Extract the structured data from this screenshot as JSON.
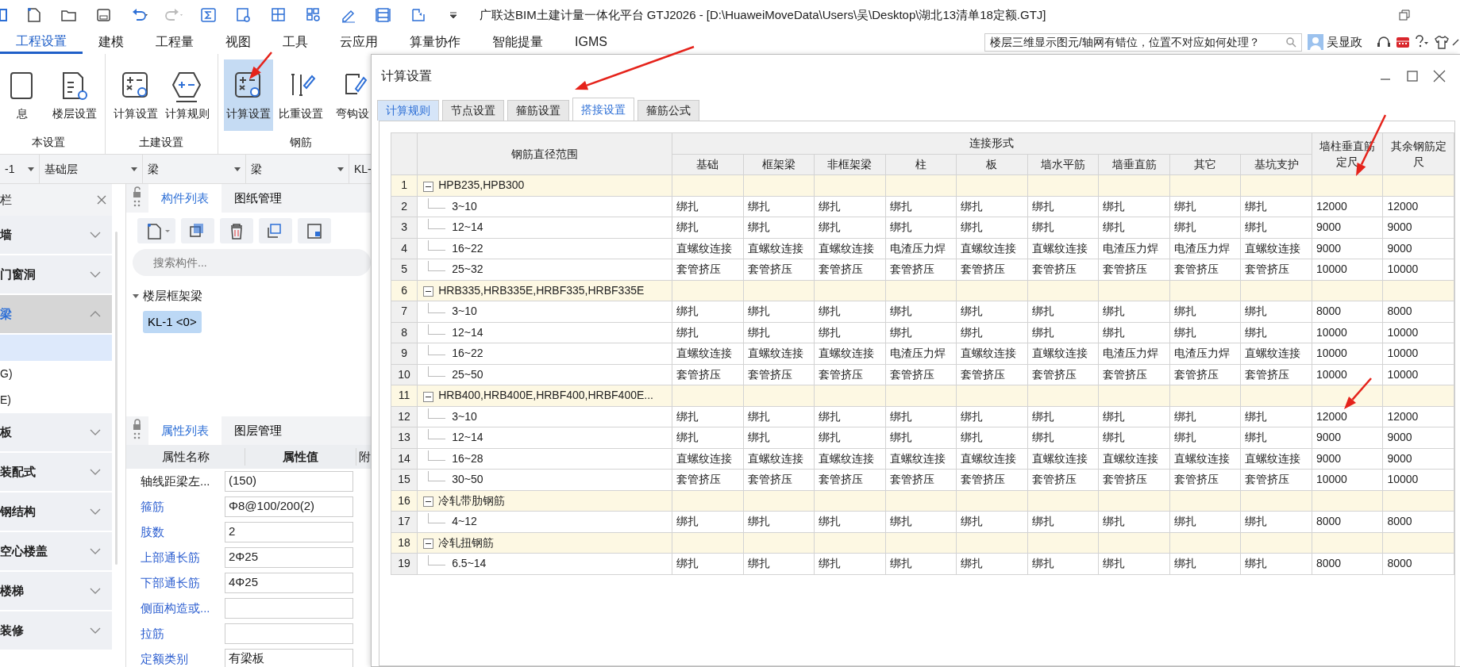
{
  "title_bar": {
    "title": "广联达BIM土建计量一体化平台 GTJ2026 - [D:\\HuaweiMoveData\\Users\\吴\\Desktop\\湖北13清单18定额.GTJ]"
  },
  "menu_tabs": [
    {
      "label": "工程设置",
      "selected": true
    },
    {
      "label": "建模",
      "selected": false
    },
    {
      "label": "工程量",
      "selected": false
    },
    {
      "label": "视图",
      "selected": false
    },
    {
      "label": "工具",
      "selected": false
    },
    {
      "label": "云应用",
      "selected": false
    },
    {
      "label": "算量协作",
      "selected": false
    },
    {
      "label": "智能提量",
      "selected": false
    },
    {
      "label": "IGMS",
      "selected": false
    }
  ],
  "help_search": {
    "value": "楼层三维显示图元/轴网有错位，位置不对应如何处理？"
  },
  "user": {
    "name": "吴显政"
  },
  "ribbon": [
    {
      "label": "本设置",
      "buttons": [
        {
          "label": "息",
          "selected": false
        },
        {
          "label": "楼层设置",
          "selected": false
        }
      ]
    },
    {
      "label": "土建设置",
      "buttons": [
        {
          "label": "计算设置",
          "selected": false
        },
        {
          "label": "计算规则",
          "selected": false
        }
      ]
    },
    {
      "label": "钢筋",
      "buttons": [
        {
          "label": "计算设置",
          "selected": true
        },
        {
          "label": "比重设置",
          "selected": false
        },
        {
          "label": "弯钩设",
          "selected": false
        }
      ]
    }
  ],
  "selectors": [
    "-1",
    "基础层",
    "梁",
    "梁",
    "KL-"
  ],
  "nav_panel": {
    "title": "栏",
    "items": [
      {
        "label": "墙",
        "expanded": false
      },
      {
        "label": "门窗洞",
        "expanded": false
      },
      {
        "label": "梁",
        "expanded": true,
        "children": [
          {
            "selected": true
          },
          {
            "label": "G)",
            "selected": false
          },
          {
            "label": "E)",
            "selected": false
          }
        ]
      },
      {
        "label": "板",
        "expanded": false
      },
      {
        "label": "装配式",
        "expanded": false
      },
      {
        "label": "钢结构",
        "expanded": false
      },
      {
        "label": "空心楼盖",
        "expanded": false
      },
      {
        "label": "楼梯",
        "expanded": false
      },
      {
        "label": "装修",
        "expanded": false
      }
    ]
  },
  "component_panel": {
    "tabs": [
      {
        "label": "构件列表",
        "selected": true
      },
      {
        "label": "图纸管理",
        "selected": false
      }
    ],
    "search": {
      "placeholder": "搜索构件..."
    },
    "tree": [
      {
        "label": "楼层框架梁",
        "expanded": true,
        "children": [
          {
            "label": "KL-1 <0>",
            "selected": true
          }
        ]
      }
    ]
  },
  "property_panel": {
    "tabs": [
      {
        "label": "属性列表",
        "selected": true
      },
      {
        "label": "图层管理",
        "selected": false
      }
    ],
    "columns": [
      "属性名称",
      "属性值",
      "附"
    ],
    "rows": [
      {
        "name": "轴线距梁左...",
        "value": "(150)",
        "color": "#222222"
      },
      {
        "name": "箍筋",
        "value": "Φ8@100/200(2)",
        "color": "#2d5fd0"
      },
      {
        "name": "肢数",
        "value": "2",
        "color": "#2d5fd0"
      },
      {
        "name": "上部通长筋",
        "value": "2Φ25",
        "color": "#2d5fd0"
      },
      {
        "name": "下部通长筋",
        "value": "4Φ25",
        "color": "#2d5fd0"
      },
      {
        "name": "侧面构造或...",
        "color": "#2d5fd0"
      },
      {
        "name": "拉筋",
        "color": "#2d5fd0"
      },
      {
        "name": "定额类别",
        "value": "有梁板",
        "color": "#2d5fd0"
      }
    ]
  },
  "dialog": {
    "title": "计算设置",
    "tabs": [
      {
        "label": "计算规则",
        "selected": false,
        "hovered": true
      },
      {
        "label": "节点设置",
        "selected": false,
        "hovered": false
      },
      {
        "label": "箍筋设置",
        "selected": false,
        "hovered": false
      },
      {
        "label": "搭接设置",
        "selected": true,
        "hovered": false
      },
      {
        "label": "箍筋公式",
        "selected": false,
        "hovered": false
      }
    ],
    "table": {
      "name_header": "钢筋直径范围",
      "group_header": "连接形式",
      "group_columns": [
        "基础",
        "框架梁",
        "非框架梁",
        "柱",
        "板",
        "墙水平筋",
        "墙垂直筋",
        "其它",
        "基坑支护"
      ],
      "extra_columns": [
        "墙柱垂直筋定尺",
        "其余钢筋定尺"
      ],
      "rows": [
        {
          "number": "1",
          "kind": "group",
          "label": "HPB235,HPB300",
          "expanded": true
        },
        {
          "number": "2",
          "kind": "item",
          "label": "3~10",
          "cells": [
            "绑扎",
            "绑扎",
            "绑扎",
            "绑扎",
            "绑扎",
            "绑扎",
            "绑扎",
            "绑扎",
            "绑扎",
            "12000",
            "12000"
          ]
        },
        {
          "number": "3",
          "kind": "item",
          "label": "12~14",
          "cells": [
            "绑扎",
            "绑扎",
            "绑扎",
            "绑扎",
            "绑扎",
            "绑扎",
            "绑扎",
            "绑扎",
            "绑扎",
            "9000",
            "9000"
          ]
        },
        {
          "number": "4",
          "kind": "item",
          "label": "16~22",
          "cells": [
            "直螺纹连接",
            "直螺纹连接",
            "直螺纹连接",
            "电渣压力焊",
            "直螺纹连接",
            "直螺纹连接",
            "电渣压力焊",
            "电渣压力焊",
            "直螺纹连接",
            "9000",
            "9000"
          ]
        },
        {
          "number": "5",
          "kind": "item",
          "label": "25~32",
          "cells": [
            "套管挤压",
            "套管挤压",
            "套管挤压",
            "套管挤压",
            "套管挤压",
            "套管挤压",
            "套管挤压",
            "套管挤压",
            "套管挤压",
            "10000",
            "10000"
          ]
        },
        {
          "number": "6",
          "kind": "group",
          "label": "HRB335,HRB335E,HRBF335,HRBF335E",
          "expanded": true
        },
        {
          "number": "7",
          "kind": "item",
          "label": "3~10",
          "cells": [
            "绑扎",
            "绑扎",
            "绑扎",
            "绑扎",
            "绑扎",
            "绑扎",
            "绑扎",
            "绑扎",
            "绑扎",
            "8000",
            "8000"
          ]
        },
        {
          "number": "8",
          "kind": "item",
          "label": "12~14",
          "cells": [
            "绑扎",
            "绑扎",
            "绑扎",
            "绑扎",
            "绑扎",
            "绑扎",
            "绑扎",
            "绑扎",
            "绑扎",
            "10000",
            "10000"
          ]
        },
        {
          "number": "9",
          "kind": "item",
          "label": "16~22",
          "cells": [
            "直螺纹连接",
            "直螺纹连接",
            "直螺纹连接",
            "电渣压力焊",
            "直螺纹连接",
            "直螺纹连接",
            "电渣压力焊",
            "电渣压力焊",
            "直螺纹连接",
            "10000",
            "10000"
          ]
        },
        {
          "number": "10",
          "kind": "item",
          "label": "25~50",
          "cells": [
            "套管挤压",
            "套管挤压",
            "套管挤压",
            "套管挤压",
            "套管挤压",
            "套管挤压",
            "套管挤压",
            "套管挤压",
            "套管挤压",
            "10000",
            "10000"
          ]
        },
        {
          "number": "11",
          "kind": "group",
          "label": "HRB400,HRB400E,HRBF400,HRBF400E...",
          "expanded": true
        },
        {
          "number": "12",
          "kind": "item",
          "label": "3~10",
          "cells": [
            "绑扎",
            "绑扎",
            "绑扎",
            "绑扎",
            "绑扎",
            "绑扎",
            "绑扎",
            "绑扎",
            "绑扎",
            "12000",
            "12000"
          ]
        },
        {
          "number": "13",
          "kind": "item",
          "label": "12~14",
          "cells": [
            "绑扎",
            "绑扎",
            "绑扎",
            "绑扎",
            "绑扎",
            "绑扎",
            "绑扎",
            "绑扎",
            "绑扎",
            "9000",
            "9000"
          ]
        },
        {
          "number": "14",
          "kind": "item",
          "label": "16~28",
          "cells": [
            "直螺纹连接",
            "直螺纹连接",
            "直螺纹连接",
            "直螺纹连接",
            "直螺纹连接",
            "直螺纹连接",
            "直螺纹连接",
            "直螺纹连接",
            "直螺纹连接",
            "9000",
            "9000"
          ]
        },
        {
          "number": "15",
          "kind": "item",
          "label": "30~50",
          "cells": [
            "套管挤压",
            "套管挤压",
            "套管挤压",
            "套管挤压",
            "套管挤压",
            "套管挤压",
            "套管挤压",
            "套管挤压",
            "套管挤压",
            "10000",
            "10000"
          ]
        },
        {
          "number": "16",
          "kind": "group",
          "label": "冷轧带肋钢筋",
          "expanded": true
        },
        {
          "number": "17",
          "kind": "item",
          "label": "4~12",
          "cells": [
            "绑扎",
            "绑扎",
            "绑扎",
            "绑扎",
            "绑扎",
            "绑扎",
            "绑扎",
            "绑扎",
            "绑扎",
            "8000",
            "8000"
          ]
        },
        {
          "number": "18",
          "kind": "group",
          "label": "冷轧扭钢筋",
          "expanded": true
        },
        {
          "number": "19",
          "kind": "item",
          "label": "6.5~14",
          "cells": [
            "绑扎",
            "绑扎",
            "绑扎",
            "绑扎",
            "绑扎",
            "绑扎",
            "绑扎",
            "绑扎",
            "绑扎",
            "8000",
            "8000"
          ]
        }
      ]
    }
  }
}
